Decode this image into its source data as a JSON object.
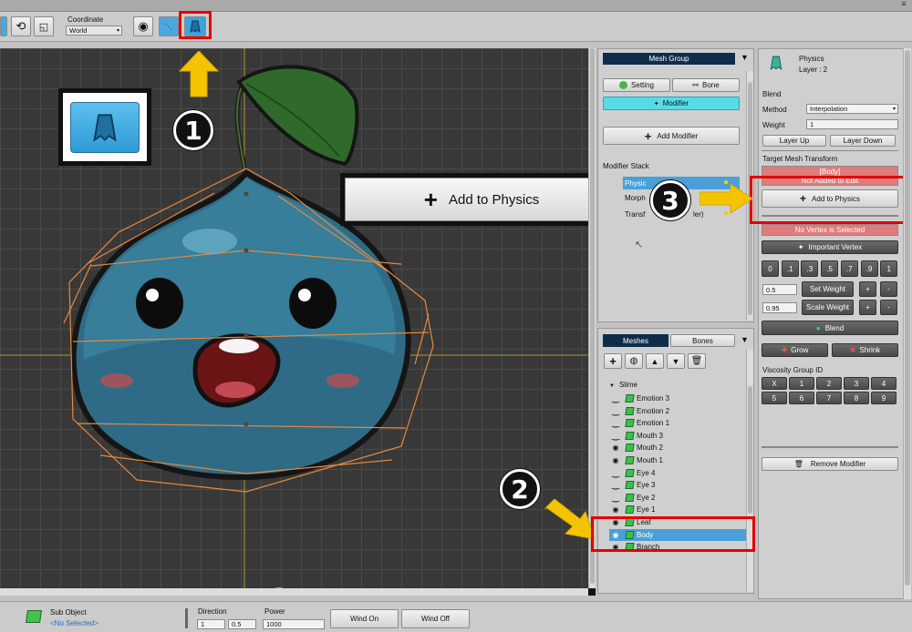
{
  "toolbar": {
    "coordinate_label": "Coordinate",
    "coordinate_value": "World",
    "icons": [
      "mesh-tool-icon",
      "rotate-icon",
      "transform-icon",
      "onion-skin-icon",
      "bone-mode-icon",
      "physics-mode-icon"
    ]
  },
  "canvas": {
    "physics_preview_label": "",
    "callout_1": "1",
    "callout_2": "2",
    "callout_3": "3",
    "add_to_physics_large": "Add to Physics"
  },
  "mesh_group_panel": {
    "header": "Mesh Group",
    "setting_btn": "Setting",
    "bone_btn": "Bone",
    "modifier_tab": "Modifier",
    "add_modifier_btn": "Add Modifier",
    "stack_label": "Modifier Stack",
    "stack_items": [
      "Physics",
      "Morph",
      "Transform (Controller)"
    ],
    "stack_items_visible": [
      "Physic",
      "Morph",
      "Transf",
      "ler)"
    ]
  },
  "meshes_panel": {
    "tab_meshes": "Meshes",
    "tab_bones": "Bones",
    "root": "Slime",
    "items": [
      {
        "name": "Emotion 3",
        "visible": false
      },
      {
        "name": "Emotion 2",
        "visible": false
      },
      {
        "name": "Emotion 1",
        "visible": false
      },
      {
        "name": "Mouth 3",
        "visible": false
      },
      {
        "name": "Mouth 2",
        "visible": true
      },
      {
        "name": "Mouth 1",
        "visible": true
      },
      {
        "name": "Eye 4",
        "visible": false
      },
      {
        "name": "Eye 3",
        "visible": false
      },
      {
        "name": "Eye 2",
        "visible": false
      },
      {
        "name": "Eye 1",
        "visible": true
      },
      {
        "name": "Leaf",
        "visible": true
      },
      {
        "name": "Body",
        "visible": true,
        "selected": true
      },
      {
        "name": "Branch",
        "visible": true
      }
    ]
  },
  "inspector": {
    "title": "Physics",
    "layer": "Layer : 2",
    "blend_label": "Blend",
    "method_label": "Method",
    "method_value": "Interpolation",
    "weight_label": "Weight",
    "weight_value": "1",
    "layer_up": "Layer Up",
    "layer_down": "Layer Down",
    "target_label": "Target Mesh Transform",
    "target_name": "[Body]",
    "target_status": "Not Added to Edit",
    "add_to_physics": "Add to Physics",
    "no_vertex": "No Vertex is Selected",
    "important_vertex": "Important Vertex",
    "weight_presets": [
      "0",
      ".1",
      ".3",
      ".5",
      ".7",
      ".9",
      "1"
    ],
    "set_weight_value": "0.5",
    "set_weight": "Set Weight",
    "scale_weight_value": "0.95",
    "scale_weight": "Scale Weight",
    "plus": "+",
    "minus": "-",
    "blend_btn": "Blend",
    "grow": "Grow",
    "shrink": "Shrink",
    "viscosity_label": "Viscosity Group ID",
    "viscosity_ids": [
      "X",
      "1",
      "2",
      "3",
      "4",
      "5",
      "6",
      "7",
      "8",
      "9"
    ],
    "remove_modifier": "Remove Modifier"
  },
  "bottom_bar": {
    "sub_object_label": "Sub Object",
    "sub_object_value": "<No Selected>",
    "direction_label": "Direction",
    "direction_x": "1",
    "direction_y": "0.5",
    "power_label": "Power",
    "power_value": "1000",
    "wind_on": "Wind On",
    "wind_off": "Wind Off"
  },
  "colors": {
    "canvas_bg": "#383838",
    "grid": "#4a4a4a",
    "accent_blue": "#4aa8de",
    "selected_row": "#4a9fd8",
    "warning_red": "#e07b7b",
    "callout_red": "#e30000",
    "arrow_yellow": "#f5c400",
    "slime_blue": "#3a7f9c",
    "orange_mesh": "#e8893a"
  }
}
